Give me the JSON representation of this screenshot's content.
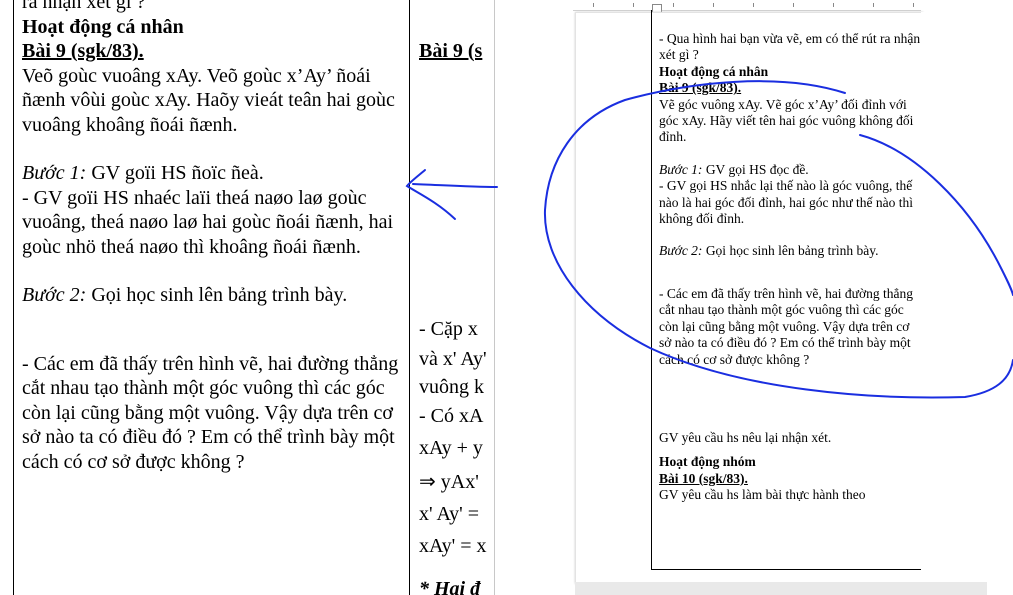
{
  "big_doc": {
    "top_partial": "ra nhận xét gì ?",
    "heading": "Hoạt động cá nhân",
    "exercise": "Bài 9 (sgk/83).",
    "task": "Veõ goùc vuoâng xAy. Veõ goùc x’Ay’ ñoái ñænh vôùi goùc xAy. Haõy vieát teân hai goùc vuoâng khoâng ñoái ñænh.",
    "step1_label": "Bước 1:",
    "step1_text": " GV goïi HS ñoïc ñeà.",
    "step1_detail": "- GV goïi HS nhaéc laïi theá naøo laø goùc vuoâng, theá naøo laø hai goùc ñoái ñænh, hai goùc nhö theá naøo thì khoâng ñoái ñænh.",
    "step2_label": "Bước 2:",
    "step2_text": " Gọi học sinh lên bảng trình bày.",
    "question": "- Các em đã thấy trên hình vẽ, hai đường thẳng cắt nhau tạo thành một góc vuông thì các góc còn lại cũng bằng một vuông. Vậy dựa trên cơ sở nào ta có điều đó ? Em có thể trình bày một cách có cơ sở được không ?",
    "mid_title": "Bài 9 (s",
    "mid_rows": [
      "- Cặp x",
      "và x' Ay'",
      "vuông k",
      "- Có xA",
      "xAy + y",
      "⇒ yAx'",
      "x' Ay' =",
      "xAy' = x",
      "* Hai đ"
    ]
  },
  "word_doc": {
    "intro": "- Qua hình hai bạn vừa vẽ, em có thể rút ra nhận xét gì ?",
    "heading": "Hoạt động cá nhân",
    "exercise": "Bài 9 (sgk/83).",
    "task": "Vẽ góc vuông xAy. Vẽ góc x’Ay’ đối đỉnh với góc xAy. Hãy viết tên hai góc vuông không đối đỉnh.",
    "step1_label": "Bước 1:",
    "step1_text": "  GV gọi HS đọc đề.",
    "step1_detail": "- GV gọi HS nhắc lại thế nào là góc vuông, thế nào là hai góc đối đỉnh, hai góc như thế nào thì không đối đỉnh.",
    "step2_label": "Bước 2:",
    "step2_text": " Gọi học sinh lên bảng trình bày.",
    "question": "- Các em đã thấy trên hình vẽ, hai đường thẳng cắt nhau tạo thành một góc vuông thì các góc còn lại cũng bằng một vuông. Vậy dựa trên cơ sở nào ta có điều đó ? Em có thể trình bày một cách có cơ sở được không ?",
    "recall": "GV yêu cầu hs nêu lại nhận xét.",
    "group_heading": "Hoạt động nhóm",
    "exercise10": "Bài 10 (sgk/83).",
    "exercise10_text": "GV yêu cầu hs làm bài thực hành theo"
  },
  "colors": {
    "annotation": "#1a2ee0",
    "text": "#000000"
  },
  "icons": {
    "annotation": "freehand-pen-stroke"
  }
}
